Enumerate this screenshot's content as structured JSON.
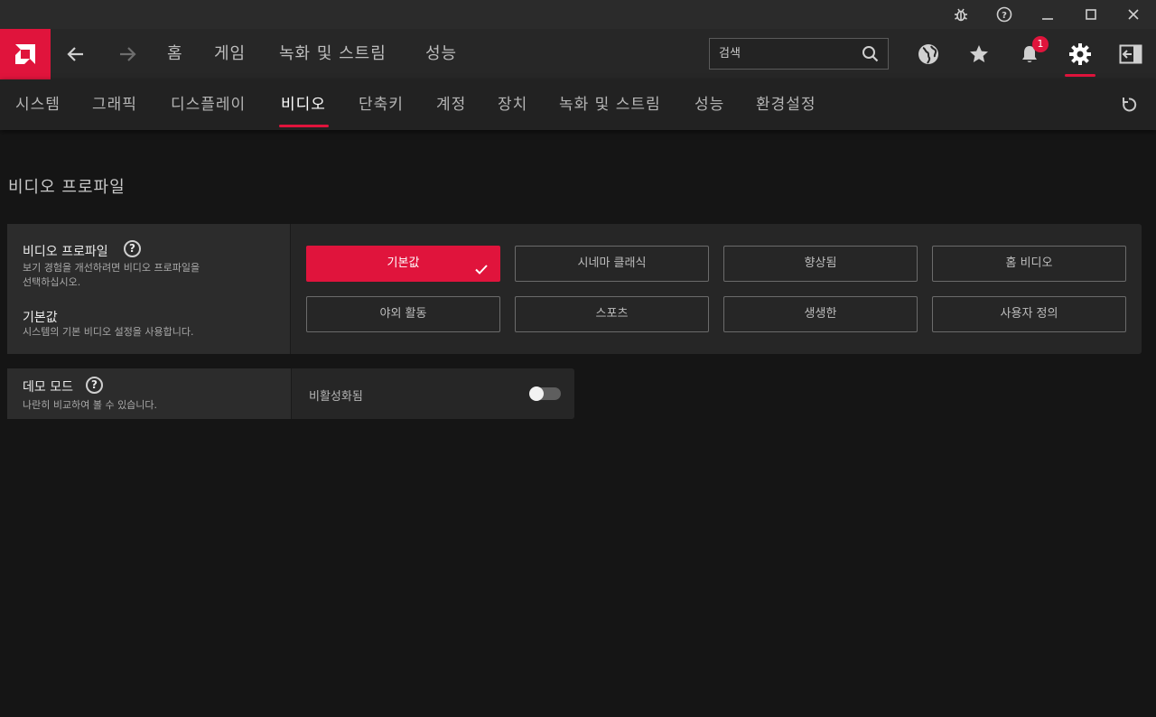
{
  "titlebar": {
    "icons": [
      "bug-icon",
      "help-icon",
      "minimize-icon",
      "maximize-icon",
      "close-icon"
    ]
  },
  "nav": {
    "back_icon": "arrow-left-icon",
    "forward_icon": "arrow-right-icon",
    "links": [
      "홈",
      "게임",
      "녹화 및 스트림",
      "성능"
    ],
    "search_placeholder": "검색",
    "notification_count": "1",
    "right_icons": [
      "globe-icon",
      "star-icon",
      "bell-icon",
      "gear-icon",
      "exit-panel-icon"
    ]
  },
  "subnav": {
    "tabs": [
      "시스템",
      "그래픽",
      "디스플레이",
      "비디오",
      "단축키",
      "계정",
      "장치",
      "녹화 및 스트림",
      "성능",
      "환경설정"
    ],
    "active_tab": "비디오"
  },
  "content": {
    "section_title": "비디오 프로파일",
    "profile": {
      "title": "비디오 프로파일",
      "desc_line1": "보기 경험을 개선하려면 비디오 프로파일을",
      "desc_line2": "선택하십시오.",
      "current_title": "기본값",
      "current_desc": "시스템의 기본 비디오 설정을 사용합니다.",
      "options": [
        "기본값",
        "시네마 클래식",
        "향상됨",
        "홈 비디오",
        "야외 활동",
        "스포츠",
        "생생한",
        "사용자 정의"
      ],
      "selected": "기본값"
    },
    "demo": {
      "title": "데모 모드",
      "desc": "나란히 비교하여 볼 수 있습니다.",
      "toggle_label": "비활성화됨",
      "enabled": false
    }
  },
  "colors": {
    "accent": "#e0143c",
    "background": "#151515",
    "panel": "#262626"
  }
}
